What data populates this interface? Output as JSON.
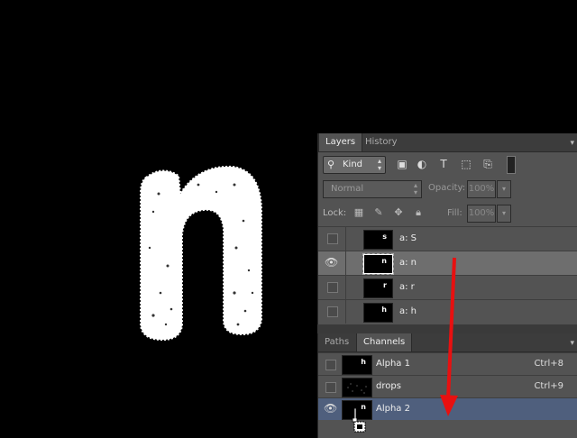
{
  "canvas": {
    "letter": "n",
    "background": "#000000"
  },
  "layers_panel": {
    "tabs": [
      {
        "label": "Layers",
        "active": true
      },
      {
        "label": "History",
        "active": false
      }
    ],
    "menu_icon": "panel-menu-icon",
    "filter": {
      "kind_label": "Kind",
      "icons": [
        "image-filter-icon",
        "adjustment-filter-icon",
        "type-filter-icon",
        "shape-filter-icon",
        "smart-object-filter-icon"
      ]
    },
    "blend_mode": "Normal",
    "opacity_label": "Opacity:",
    "opacity_value": "100%",
    "lock_label": "Lock:",
    "fill_label": "Fill:",
    "fill_value": "100%",
    "layers": [
      {
        "name": "a: S",
        "visible": false,
        "selected": false,
        "thumb_glyph": "s"
      },
      {
        "name": "a: n",
        "visible": true,
        "selected": true,
        "thumb_glyph": "n"
      },
      {
        "name": "a: r",
        "visible": false,
        "selected": false,
        "thumb_glyph": "r"
      },
      {
        "name": "a: h",
        "visible": false,
        "selected": false,
        "thumb_glyph": "h"
      }
    ]
  },
  "channels_panel": {
    "tabs": [
      {
        "label": "Paths",
        "active": false
      },
      {
        "label": "Channels",
        "active": true
      }
    ],
    "channels": [
      {
        "name": "Alpha 1",
        "shortcut": "Ctrl+8",
        "visible": false,
        "selected": false,
        "thumb_glyph": "h"
      },
      {
        "name": "drops",
        "shortcut": "Ctrl+9",
        "visible": false,
        "selected": false,
        "thumb_glyph": ""
      },
      {
        "name": "Alpha 2",
        "shortcut": "",
        "visible": true,
        "selected": true,
        "thumb_glyph": "n"
      }
    ]
  },
  "colors": {
    "annotation_arrow": "#e81010",
    "selected_channel": "#4f5f7d",
    "selected_layer": "#6e6e6e"
  }
}
